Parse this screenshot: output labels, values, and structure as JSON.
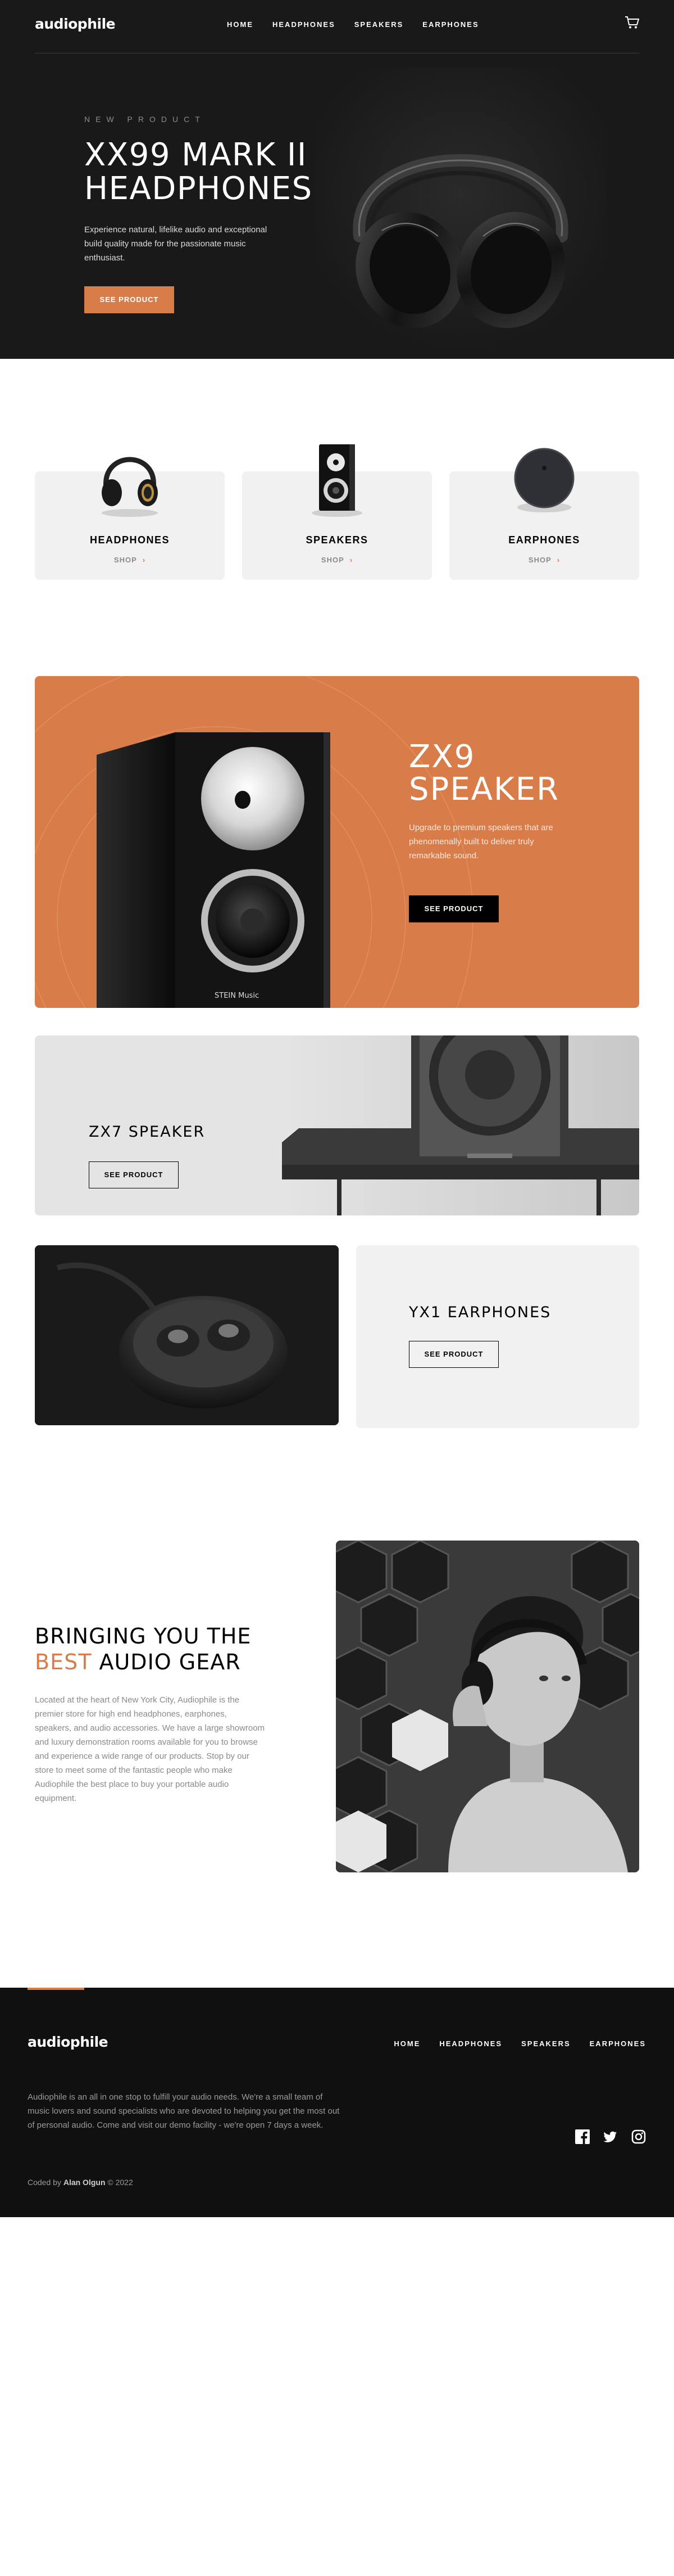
{
  "header": {
    "logo": "audiophile",
    "nav": [
      "HOME",
      "HEADPHONES",
      "SPEAKERS",
      "EARPHONES"
    ],
    "cart_icon": "cart-icon"
  },
  "hero": {
    "eyebrow": "NEW PRODUCT",
    "title_line1": "XX99 MARK II",
    "title_line2": "HEADPHONES",
    "description": "Experience natural, lifelike audio and exceptional build quality made for the passionate music enthusiast.",
    "button": "SEE PRODUCT"
  },
  "categories": [
    {
      "title": "HEADPHONES",
      "shop": "SHOP"
    },
    {
      "title": "SPEAKERS",
      "shop": "SHOP"
    },
    {
      "title": "EARPHONES",
      "shop": "SHOP"
    }
  ],
  "zx9": {
    "title_line1": "ZX9",
    "title_line2": "SPEAKER",
    "description": "Upgrade to premium speakers that are phenomenally built to deliver truly remarkable sound.",
    "button": "SEE PRODUCT",
    "speaker_brand": "STEIN Music"
  },
  "zx7": {
    "title": "ZX7 SPEAKER",
    "button": "SEE PRODUCT"
  },
  "yx1": {
    "title": "YX1 EARPHONES",
    "button": "SEE PRODUCT"
  },
  "about": {
    "title_line1": "BRINGING YOU THE",
    "title_accent": "BEST",
    "title_rest": " AUDIO GEAR",
    "description": "Located at the heart of New York City, Audiophile is the premier store for high end headphones, earphones, speakers, and audio accessories. We have a large showroom and luxury demonstration rooms available for you to browse and experience a wide range of our products. Stop by our store to meet some of the fantastic people who make Audiophile the best place to buy your portable audio equipment."
  },
  "footer": {
    "logo": "audiophile",
    "nav": [
      "HOME",
      "HEADPHONES",
      "SPEAKERS",
      "EARPHONES"
    ],
    "description": "Audiophile is an all in one stop to fulfill your audio needs. We're a small team of music lovers and sound specialists who are devoted to helping you get the most out of personal audio. Come and visit our demo facility - we're open 7 days a week.",
    "credit_prefix": "Coded by ",
    "credit_name": "Alan Olgun",
    "credit_suffix": " © 2022",
    "social": [
      "facebook-icon",
      "twitter-icon",
      "instagram-icon"
    ]
  },
  "colors": {
    "accent": "#D87D4A",
    "dark": "#191919",
    "light_gray": "#F1F1F1"
  }
}
